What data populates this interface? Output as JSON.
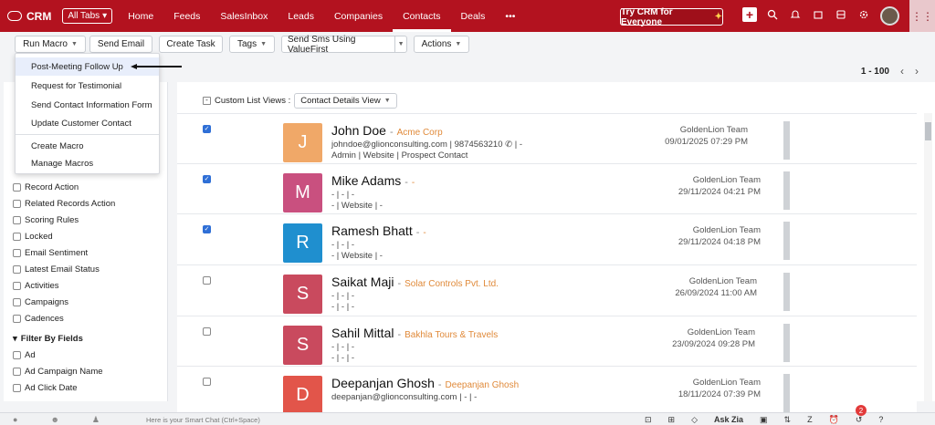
{
  "nav": {
    "brand": "CRM",
    "all_tabs": "All Tabs",
    "tabs": [
      "Home",
      "Feeds",
      "SalesInbox",
      "Leads",
      "Companies",
      "Contacts",
      "Deals",
      "•••"
    ],
    "try_crm": "Try CRM for Everyone",
    "active_tab": "Contacts"
  },
  "toolbar": {
    "run_macro": "Run Macro",
    "send_email": "Send Email",
    "create_task": "Create Task",
    "tags": "Tags",
    "send_sms": "Send Sms Using ValueFirst",
    "actions": "Actions"
  },
  "macro_menu": {
    "items": [
      "Post-Meeting Follow Up",
      "Request for Testimonial",
      "Send Contact Information Form",
      "Update Customer Contact"
    ],
    "footer_items": [
      "Create Macro",
      "Manage Macros"
    ]
  },
  "pager": {
    "range": "1 - 100"
  },
  "filters": {
    "system_items": [
      "Record Action",
      "Related Records Action",
      "Scoring Rules",
      "Locked",
      "Email Sentiment",
      "Latest Email Status",
      "Activities",
      "Campaigns",
      "Cadences"
    ],
    "by_fields_title": "Filter By Fields",
    "field_items": [
      "Ad",
      "Ad Campaign Name",
      "Ad Click Date"
    ]
  },
  "list": {
    "custom_list_views": "Custom List Views :",
    "view_name": "Contact Details View",
    "rows": [
      {
        "initial": "J",
        "name": "John Doe",
        "company": "Acme Corp",
        "line1": "johndoe@glionconsulting.com  |  9874563210  ✆   |  -",
        "line2": "Admin  |  Website  |  Prospect Contact",
        "owner": "GoldenLion Team",
        "date": "09/01/2025 07:29 PM",
        "checked": true,
        "color": "#f0a868"
      },
      {
        "initial": "M",
        "name": "Mike Adams",
        "company": "-",
        "line1": "-  |  -  |  -",
        "line2": "-  |  Website  |  -",
        "owner": "GoldenLion Team",
        "date": "29/11/2024 04:21 PM",
        "checked": true,
        "color": "#c9507f"
      },
      {
        "initial": "R",
        "name": "Ramesh Bhatt",
        "company": "-",
        "line1": "-  |  -  |  -",
        "line2": "-  |  Website  |  -",
        "owner": "GoldenLion Team",
        "date": "29/11/2024 04:18 PM",
        "checked": true,
        "color": "#1f8fcf"
      },
      {
        "initial": "S",
        "name": "Saikat Maji",
        "company": "Solar Controls Pvt. Ltd.",
        "line1": "-  |  -  |  -",
        "line2": "-  |  -  |  -",
        "owner": "GoldenLion Team",
        "date": "26/09/2024 11:00 AM",
        "checked": false,
        "color": "#c94a5e"
      },
      {
        "initial": "S",
        "name": "Sahil Mittal",
        "company": "Bakhla Tours & Travels",
        "line1": "-  |  -  |  -",
        "line2": "-  |  -  |  -",
        "owner": "GoldenLion Team",
        "date": "23/09/2024 09:28 PM",
        "checked": false,
        "color": "#c94a5e"
      },
      {
        "initial": "D",
        "name": "Deepanjan Ghosh",
        "company": "Deepanjan Ghosh",
        "line1": "deepanjan@glionconsulting.com  |  -  |  -",
        "line2": "",
        "owner": "GoldenLion Team",
        "date": "18/11/2024 07:39 PM",
        "checked": false,
        "color": "#e2554a"
      }
    ]
  },
  "bottom": {
    "smart_chat": "Here is your Smart Chat (Ctrl+Space)",
    "ask_zia": "Ask Zia",
    "notification_count": "2"
  },
  "colors": {
    "brand_red": "#b3121f",
    "accent_blue": "#2f6fd6",
    "company_orange": "#e08a3a"
  }
}
